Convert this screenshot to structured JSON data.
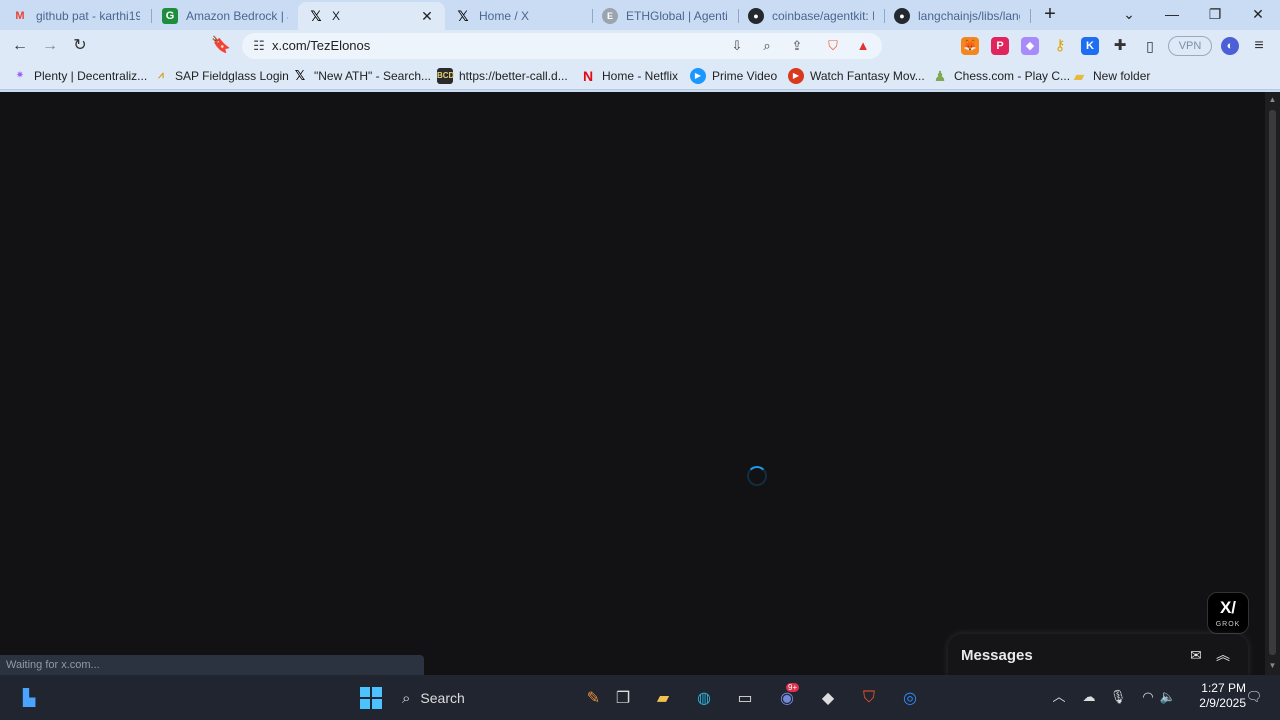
{
  "tabs": [
    {
      "title": "github pat - karthi190",
      "icon": "gmail-icon"
    },
    {
      "title": "Amazon Bedrock | ap-",
      "icon": "google-sheets-icon"
    },
    {
      "title": "X",
      "icon": "x-logo-icon",
      "active": true
    },
    {
      "title": "Home / X",
      "icon": "x-logo-icon"
    },
    {
      "title": "ETHGlobal | Agentic E",
      "icon": "ethglobal-icon"
    },
    {
      "title": "coinbase/agentkit: Eve",
      "icon": "github-icon"
    },
    {
      "title": "langchainjs/libs/langc",
      "icon": "github-icon"
    }
  ],
  "address_bar": {
    "url": "x.com/TezElonos"
  },
  "bookmarks": [
    {
      "label": "Plenty | Decentraliz...",
      "icon": "plenty-icon"
    },
    {
      "label": "SAP Fieldglass Login",
      "icon": "sap-icon"
    },
    {
      "label": "\"New ATH\" - Search...",
      "icon": "x-logo-icon"
    },
    {
      "label": "https://better-call.d...",
      "icon": "bcd-icon"
    },
    {
      "label": "Home - Netflix",
      "icon": "netflix-icon"
    },
    {
      "label": "Prime Video",
      "icon": "prime-video-icon"
    },
    {
      "label": "Watch Fantasy Mov...",
      "icon": "play-icon"
    },
    {
      "label": "Chess.com - Play C...",
      "icon": "chess-icon"
    },
    {
      "label": "New folder",
      "icon": "folder-icon"
    }
  ],
  "toolbar": {
    "vpn_label": "VPN",
    "shields_count": "1"
  },
  "page": {
    "status_text": "Waiting for x.com...",
    "grok_label": "GROK",
    "messages_title": "Messages"
  },
  "taskbar": {
    "search_label": "Search",
    "discord_badge": "9+",
    "time": "1:27 PM",
    "date": "2/9/2025"
  },
  "colors": {
    "accent": "#1d9bf0",
    "page_bg": "#121214",
    "chrome_bg": "#dde9f7"
  }
}
